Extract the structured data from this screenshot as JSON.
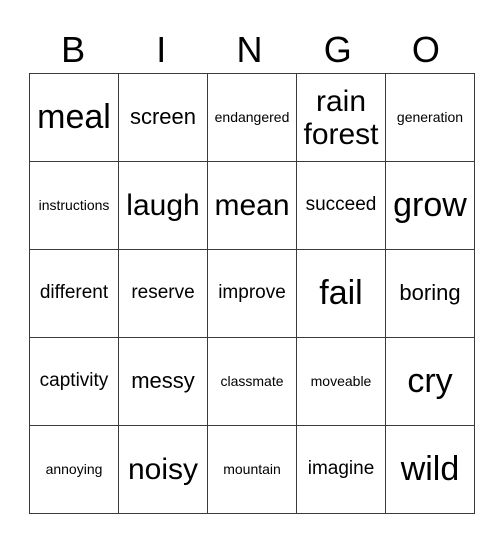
{
  "header": [
    "B",
    "I",
    "N",
    "G",
    "O"
  ],
  "rows": [
    [
      {
        "text": "meal",
        "size": "xl"
      },
      {
        "text": "screen",
        "size": "md"
      },
      {
        "text": "endangered",
        "size": "xs"
      },
      {
        "text": "rain forest",
        "size": "lg"
      },
      {
        "text": "generation",
        "size": "xs"
      }
    ],
    [
      {
        "text": "instructions",
        "size": "xs"
      },
      {
        "text": "laugh",
        "size": "lg"
      },
      {
        "text": "mean",
        "size": "lg"
      },
      {
        "text": "succeed",
        "size": "sm"
      },
      {
        "text": "grow",
        "size": "xl"
      }
    ],
    [
      {
        "text": "different",
        "size": "sm"
      },
      {
        "text": "reserve",
        "size": "sm"
      },
      {
        "text": "improve",
        "size": "sm"
      },
      {
        "text": "fail",
        "size": "xl"
      },
      {
        "text": "boring",
        "size": "md"
      }
    ],
    [
      {
        "text": "captivity",
        "size": "sm"
      },
      {
        "text": "messy",
        "size": "md"
      },
      {
        "text": "classmate",
        "size": "xs"
      },
      {
        "text": "moveable",
        "size": "xs"
      },
      {
        "text": "cry",
        "size": "xl"
      }
    ],
    [
      {
        "text": "annoying",
        "size": "xs"
      },
      {
        "text": "noisy",
        "size": "lg"
      },
      {
        "text": "mountain",
        "size": "xs"
      },
      {
        "text": "imagine",
        "size": "sm"
      },
      {
        "text": "wild",
        "size": "xl"
      }
    ]
  ]
}
